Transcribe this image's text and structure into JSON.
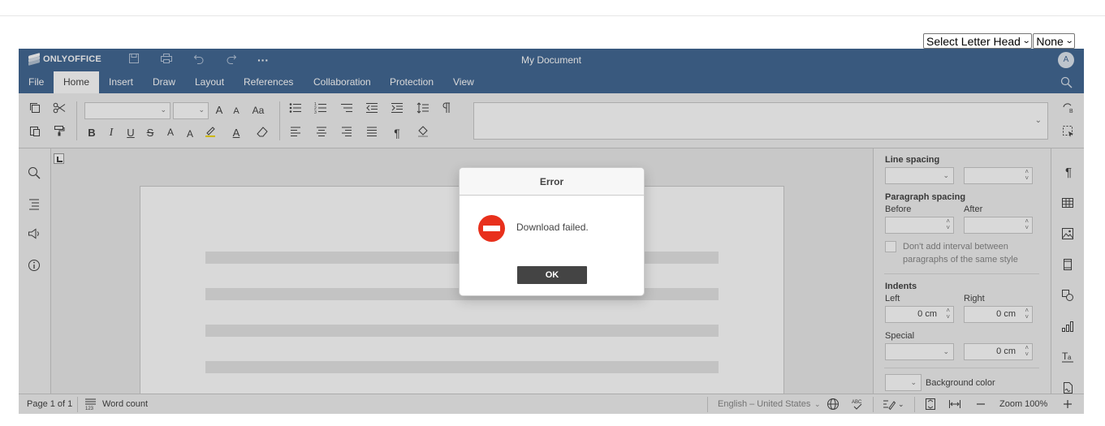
{
  "letterhead": {
    "select_label": "Select Letter Head",
    "none_label": "None"
  },
  "titlebar": {
    "logo_text": "ONLYOFFICE",
    "document_title": "My Document",
    "avatar_initial": "A",
    "quick_actions": [
      "save-icon",
      "print-icon",
      "undo-icon",
      "redo-icon",
      "more-icon"
    ],
    "more_glyph": "···"
  },
  "tabs": [
    {
      "label": "File"
    },
    {
      "label": "Home"
    },
    {
      "label": "Insert"
    },
    {
      "label": "Draw"
    },
    {
      "label": "Layout"
    },
    {
      "label": "References"
    },
    {
      "label": "Collaboration"
    },
    {
      "label": "Protection"
    },
    {
      "label": "View"
    }
  ],
  "active_tab": "Home",
  "toolbar": {
    "font_size_up": "A",
    "font_size_down": "A",
    "change_case": "Aa",
    "bold": "B",
    "italic": "I",
    "underline": "U",
    "strikethrough": "S",
    "superscript": "A",
    "subscript": "A",
    "font_color": "A",
    "paragraph_mark": "¶"
  },
  "right_panel": {
    "line_spacing_label": "Line spacing",
    "paragraph_spacing_label": "Paragraph spacing",
    "before_label": "Before",
    "after_label": "After",
    "no_interval_label_1": "Don't add interval between",
    "no_interval_label_2": "paragraphs of the same style",
    "indents_label": "Indents",
    "left_label": "Left",
    "right_label": "Right",
    "left_value": "0 cm",
    "right_value": "0 cm",
    "special_label": "Special",
    "special_value": "0 cm",
    "background_color_label": "Background color"
  },
  "statusbar": {
    "page_info": "Page 1 of 1",
    "word_count": "Word count",
    "language": "English – United States",
    "zoom": "Zoom 100%"
  },
  "dialog": {
    "title": "Error",
    "message": "Download failed.",
    "ok_label": "OK"
  },
  "colors": {
    "header_blue": "#446995",
    "error_red": "#e8301c",
    "button_dark": "#444444"
  }
}
